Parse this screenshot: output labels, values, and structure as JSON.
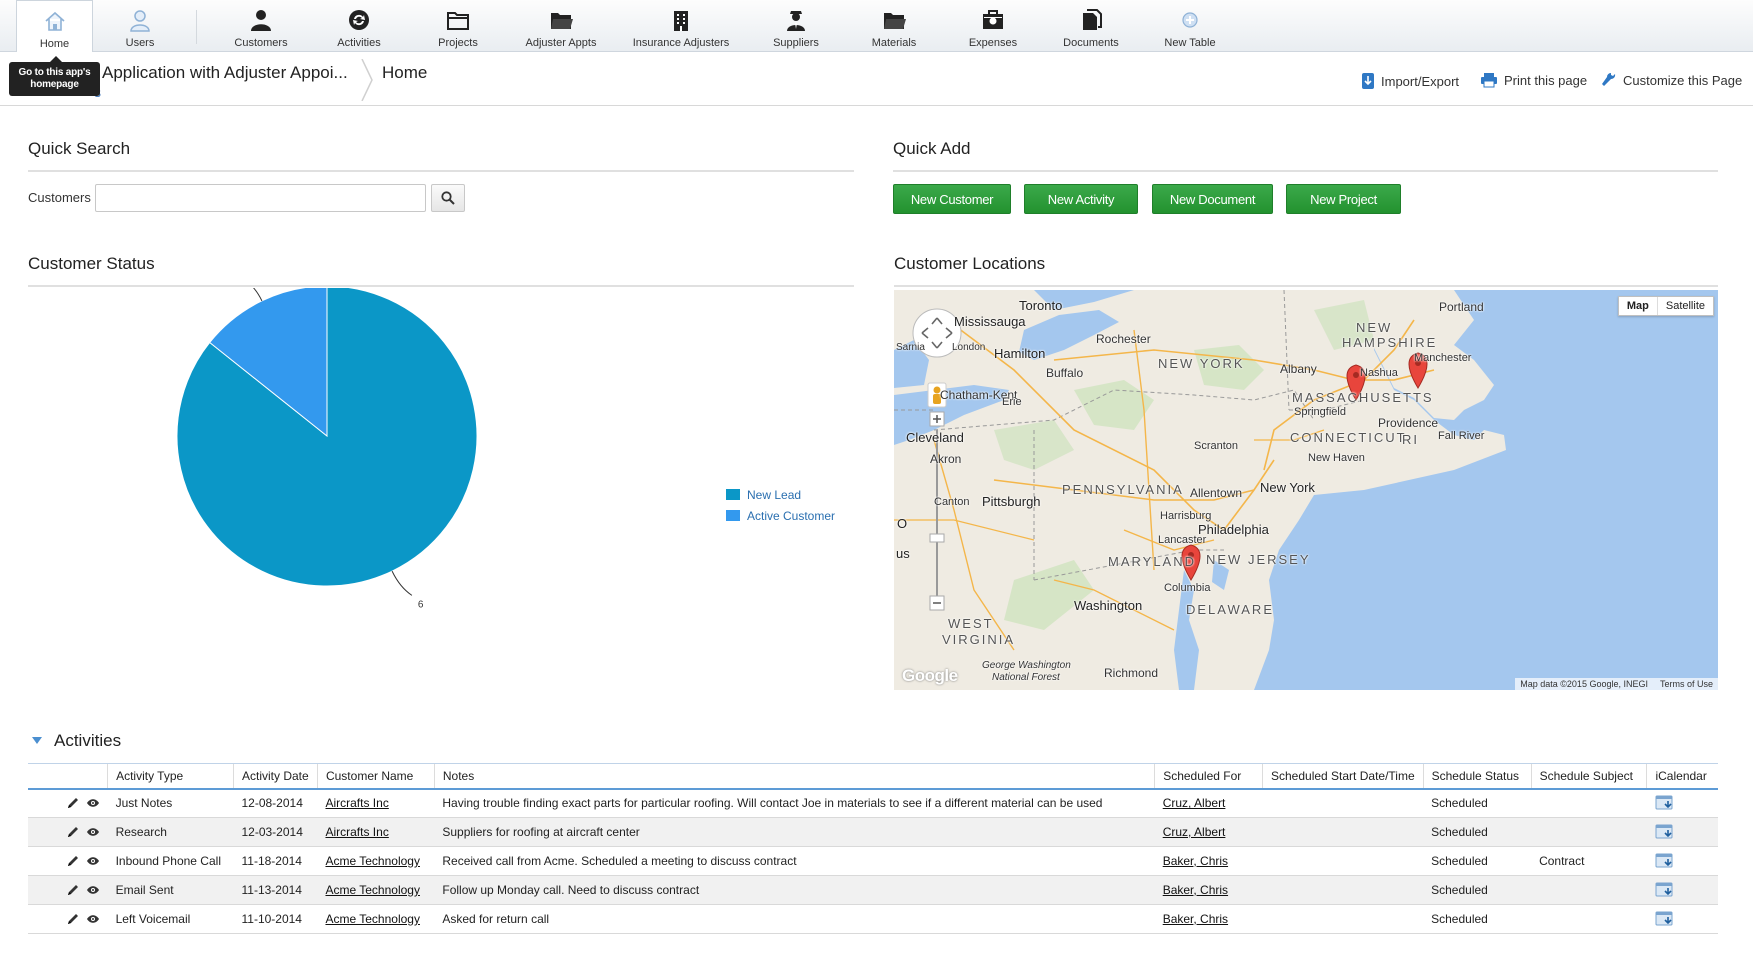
{
  "nav": {
    "items": [
      {
        "label": "Home",
        "icon": "home-icon"
      },
      {
        "label": "Users",
        "icon": "users-icon"
      },
      {
        "label": "Customers",
        "icon": "customers-icon"
      },
      {
        "label": "Activities",
        "icon": "activities-icon"
      },
      {
        "label": "Projects",
        "icon": "projects-icon"
      },
      {
        "label": "Adjuster Appts",
        "icon": "folder-icon"
      },
      {
        "label": "Insurance Adjusters",
        "icon": "building-icon"
      },
      {
        "label": "Suppliers",
        "icon": "supplier-icon"
      },
      {
        "label": "Materials",
        "icon": "folder-icon"
      },
      {
        "label": "Expenses",
        "icon": "expenses-icon"
      },
      {
        "label": "Documents",
        "icon": "documents-icon"
      },
      {
        "label": "New Table",
        "icon": "add-table-icon"
      }
    ],
    "home_tooltip": "Go to this app's homepage"
  },
  "breadcrumb": {
    "app_title": "Application with Adjuster Appoi...",
    "app_sub": "s",
    "current": "Home"
  },
  "tools": {
    "import_export": "Import/Export",
    "print": "Print this page",
    "customize": "Customize this Page"
  },
  "quick_search": {
    "title": "Quick Search",
    "label": "Customers",
    "value": "",
    "placeholder": ""
  },
  "quick_add": {
    "title": "Quick Add",
    "buttons": [
      "New Customer",
      "New Activity",
      "New Document",
      "New Project"
    ]
  },
  "customer_status": {
    "title": "Customer Status"
  },
  "chart_data": {
    "type": "pie",
    "title": "",
    "categories": [
      "New Lead",
      "Active Customer"
    ],
    "values": [
      6,
      1
    ],
    "colors": [
      "#0b97c7",
      "#3399ee"
    ],
    "legend_position": "right"
  },
  "customer_locations": {
    "title": "Customer Locations",
    "map_types": [
      "Map",
      "Satellite"
    ],
    "attribution": "Map data ©2015 Google, INEGI",
    "terms": "Terms of Use",
    "logo": "Google",
    "labels": {
      "toronto": "Toronto",
      "mississauga": "Mississauga",
      "hamilton": "Hamilton",
      "rochester": "Rochester",
      "buffalo": "Buffalo",
      "newyork_state": "NEW YORK",
      "albany": "Albany",
      "portland": "Portland",
      "newhampshire_1": "NEW",
      "newhampshire_2": "HAMPSHIRE",
      "manchester": "Manchester",
      "nashua": "Nashua",
      "massachusetts": "MASSACHUSETTS",
      "springfield": "Springfield",
      "providence": "Providence",
      "connecticut": "CONNECTICUT",
      "ri": "RI",
      "fallriver": "Fall River",
      "newhaven": "New Haven",
      "chathamkent": "Chatham-Kent",
      "erie": "Erie",
      "cleveland": "Cleveland",
      "akron": "Akron",
      "scranton": "Scranton",
      "pennsylvania": "PENNSYLVANIA",
      "allentown": "Allentown",
      "newyork_city": "New York",
      "canton": "Canton",
      "pittsburgh": "Pittsburgh",
      "harrisburg": "Harrisburg",
      "philadelphia": "Philadelphia",
      "lancaster": "Lancaster",
      "maryland": "MARYLAND",
      "newjersey": "NEW JERSEY",
      "columbia": "Columbia",
      "washington": "Washington",
      "delaware": "DELAWARE",
      "westvirginia_1": "WEST",
      "westvirginia_2": "VIRGINIA",
      "gwnf_1": "George Washington",
      "gwnf_2": "National Forest",
      "richmond": "Richmond",
      "o": "O",
      "us": "us",
      "sarnia": "Sarnia",
      "london": "London"
    }
  },
  "activities": {
    "title": "Activities",
    "columns": [
      "",
      "Activity Type",
      "Activity Date",
      "Customer Name",
      "Notes",
      "Scheduled For",
      "Scheduled Start Date/Time",
      "Schedule Status",
      "Schedule Subject",
      "iCalendar"
    ],
    "rows": [
      {
        "type": "Just Notes",
        "date": "12-08-2014",
        "customer": "Aircrafts Inc",
        "notes": "Having trouble finding exact parts for particular roofing.  Will contact Joe in materials to see if a different material can be used",
        "scheduled_for": "Cruz, Albert",
        "start": "",
        "status": "Scheduled",
        "subject": ""
      },
      {
        "type": "Research",
        "date": "12-03-2014",
        "customer": "Aircrafts Inc",
        "notes": "Suppliers for roofing at aircraft center",
        "scheduled_for": "Cruz, Albert",
        "start": "",
        "status": "Scheduled",
        "subject": ""
      },
      {
        "type": "Inbound Phone Call",
        "date": "11-18-2014",
        "customer": "Acme Technology",
        "notes": "Received call from Acme.  Scheduled a meeting to discuss contract",
        "scheduled_for": "Baker, Chris",
        "start": "",
        "status": "Scheduled",
        "subject": "Contract"
      },
      {
        "type": "Email Sent",
        "date": "11-13-2014",
        "customer": "Acme Technology",
        "notes": "Follow up Monday call.  Need to discuss contract",
        "scheduled_for": "Baker, Chris",
        "start": "",
        "status": "Scheduled",
        "subject": ""
      },
      {
        "type": "Left Voicemail",
        "date": "11-10-2014",
        "customer": "Acme Technology",
        "notes": "Asked for return call",
        "scheduled_for": "Baker, Chris",
        "start": "",
        "status": "Scheduled",
        "subject": ""
      }
    ]
  }
}
